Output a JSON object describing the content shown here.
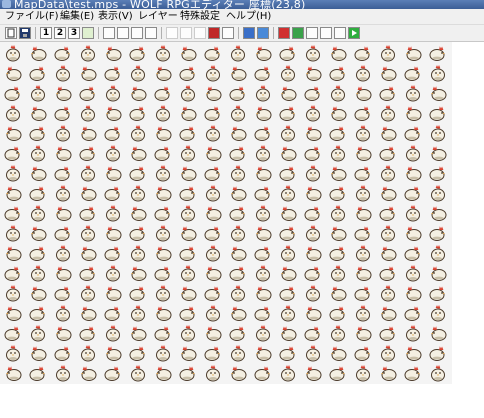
{
  "window": {
    "title": "MapData\\test.mps - WOLF RPGエディター 座標(23,8)"
  },
  "menu": {
    "items": [
      "ファイル(F)",
      "編集(E)",
      "表示(V)",
      "レイヤー",
      "特殊設定",
      "ヘルプ(H)"
    ]
  },
  "toolbar": {
    "layer_buttons": [
      "1",
      "2",
      "3"
    ]
  },
  "map": {
    "tile_name": "chicken-sprite",
    "columns": 18,
    "rows": 17,
    "colors": {
      "body": "#f4efe2",
      "outline": "#4a3a2a",
      "comb": "#d9402e",
      "beak": "#e8a33a",
      "shadow": "#c9bfa8"
    }
  }
}
